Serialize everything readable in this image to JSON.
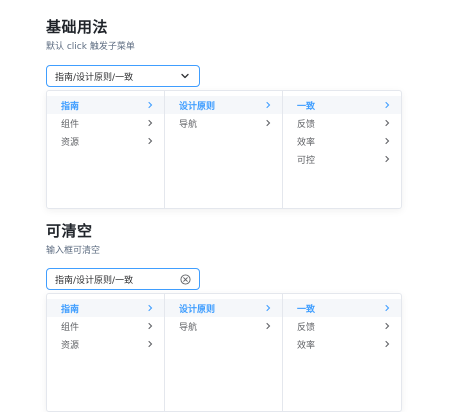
{
  "section1": {
    "title": "基础用法",
    "desc": "默认 click 触发子菜单",
    "input_value": "指南/设计原则/一致",
    "suffix_icon": "chevron-down-icon",
    "menus": [
      {
        "items": [
          {
            "label": "指南",
            "active": true
          },
          {
            "label": "组件",
            "active": false
          },
          {
            "label": "资源",
            "active": false
          }
        ]
      },
      {
        "items": [
          {
            "label": "设计原则",
            "active": true
          },
          {
            "label": "导航",
            "active": false
          }
        ]
      },
      {
        "items": [
          {
            "label": "一致",
            "active": true
          },
          {
            "label": "反馈",
            "active": false
          },
          {
            "label": "效率",
            "active": false
          },
          {
            "label": "可控",
            "active": false
          }
        ]
      }
    ]
  },
  "section2": {
    "title": "可清空",
    "desc": "输入框可清空",
    "input_value": "指南/设计原则/一致",
    "suffix_icon": "clear-icon",
    "menus": [
      {
        "items": [
          {
            "label": "指南",
            "active": true
          },
          {
            "label": "组件",
            "active": false
          },
          {
            "label": "资源",
            "active": false
          }
        ]
      },
      {
        "items": [
          {
            "label": "设计原则",
            "active": true
          },
          {
            "label": "导航",
            "active": false
          }
        ]
      },
      {
        "items": [
          {
            "label": "一致",
            "active": true
          },
          {
            "label": "反馈",
            "active": false
          },
          {
            "label": "效率",
            "active": false
          }
        ]
      }
    ]
  },
  "colors": {
    "accent": "#409eff",
    "text": "#606266",
    "border": "#e4e7ed"
  }
}
